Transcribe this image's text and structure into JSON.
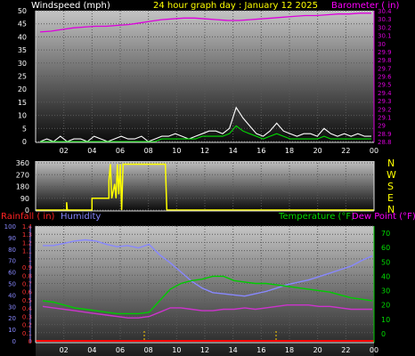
{
  "colors": {
    "background": "#000000",
    "windspeed": "#ffffff",
    "gust": "#00dd00",
    "barometer": "#dd00dd",
    "wind_dir": "#ffff00",
    "rainfall": "#ff0000",
    "rain_axis": "#ff3333",
    "humidity": "#8888ff",
    "temperature": "#00cc00",
    "dew_point": "#cc33cc",
    "dew_title": "#ff00ff",
    "tick_text": "#ffffff",
    "marker": "#ffcc00"
  },
  "header": {
    "windspeed_label": "Windspeed (mph)",
    "title": "24 hour graph day : January 12 2025",
    "barometer_label": "Barometer ( in)"
  },
  "compass": [
    "N",
    "W",
    "S",
    "E",
    "N"
  ],
  "bottom_labels": {
    "rainfall": "Rainfall ( in)",
    "humidity": "Humidity",
    "temperature": "Temperature (°F)",
    "dew_point": "Dew Point (°F)"
  },
  "chart_data": [
    {
      "type": "line",
      "x_ticks": [
        "02",
        "04",
        "06",
        "08",
        "10",
        "12",
        "14",
        "16",
        "18",
        "20",
        "22",
        "00"
      ],
      "y_left_ticks": [
        0,
        5,
        10,
        15,
        20,
        25,
        30,
        35,
        40,
        45,
        50
      ],
      "ylim_left": [
        0,
        50
      ],
      "y_right_ticks": [
        "28.8",
        "28.9",
        "29",
        "29.1",
        "29.2",
        "29.3",
        "29.4",
        "29.5",
        "29.6",
        "29.7",
        "29.8",
        "29.9",
        "30",
        "30.1",
        "30.2",
        "30.3",
        "30.4"
      ],
      "ylim_right": [
        28.8,
        30.4
      ],
      "series": [
        {
          "name": "Windspeed",
          "axis": "left",
          "color": "#ffffff",
          "values": [
            0,
            1,
            0,
            2,
            0,
            1,
            1,
            0,
            2,
            1,
            0,
            1,
            2,
            1,
            1,
            2,
            0,
            1,
            2,
            2,
            3,
            2,
            1,
            2,
            3,
            4,
            4,
            3,
            5,
            13,
            9,
            6,
            3,
            2,
            4,
            7,
            4,
            3,
            2,
            3,
            3,
            2,
            5,
            3,
            2,
            3,
            2,
            3,
            2,
            2
          ]
        },
        {
          "name": "Gust",
          "axis": "left",
          "color": "#00dd00",
          "values": [
            0,
            0,
            0,
            0,
            0,
            0,
            0,
            0,
            0,
            0,
            0,
            0,
            0,
            0,
            0,
            0,
            0,
            0,
            1,
            1,
            1,
            1,
            1,
            1,
            2,
            2,
            2,
            2,
            3,
            6,
            4,
            3,
            2,
            1,
            2,
            3,
            2,
            1,
            1,
            1,
            1,
            1,
            2,
            1,
            1,
            1,
            1,
            1,
            1,
            1
          ]
        },
        {
          "name": "Barometer",
          "axis": "right",
          "color": "#dd00dd",
          "values": [
            30.14,
            30.15,
            30.17,
            30.19,
            30.2,
            30.21,
            30.21,
            30.22,
            30.23,
            30.25,
            30.27,
            30.29,
            30.3,
            30.31,
            30.31,
            30.3,
            30.29,
            30.28,
            30.28,
            30.29,
            30.3,
            30.31,
            30.32,
            30.33,
            30.34,
            30.34,
            30.35,
            30.36,
            30.36,
            30.37,
            30.37
          ]
        }
      ]
    },
    {
      "type": "line",
      "x_ticks": [
        "02",
        "04",
        "06",
        "08",
        "10",
        "12",
        "14",
        "16",
        "18",
        "20",
        "22",
        "00"
      ],
      "y_ticks": [
        0,
        90,
        180,
        270,
        360
      ],
      "ylim": [
        0,
        360
      ],
      "series": [
        {
          "name": "Wind direction",
          "color": "#ffff00",
          "points": [
            [
              0,
              0
            ],
            [
              2.2,
              0
            ],
            [
              2.2,
              60
            ],
            [
              2.25,
              0
            ],
            [
              4,
              0
            ],
            [
              4,
              90
            ],
            [
              5.2,
              90
            ],
            [
              5.2,
              225
            ],
            [
              5.3,
              350
            ],
            [
              5.4,
              90
            ],
            [
              5.6,
              200
            ],
            [
              5.7,
              90
            ],
            [
              5.8,
              350
            ],
            [
              5.9,
              120
            ],
            [
              6.0,
              350
            ],
            [
              6.1,
              0
            ],
            [
              6.2,
              350
            ],
            [
              9.2,
              350
            ],
            [
              9.3,
              0
            ],
            [
              9.35,
              0
            ],
            [
              24,
              0
            ]
          ]
        }
      ]
    },
    {
      "type": "line",
      "x_ticks": [
        "02",
        "04",
        "06",
        "08",
        "10",
        "12",
        "14",
        "16",
        "18",
        "20",
        "22",
        "00"
      ],
      "humidity_ticks": [
        0,
        10,
        20,
        30,
        40,
        50,
        60,
        70,
        80,
        90,
        100
      ],
      "humidity_lim": [
        0,
        100
      ],
      "rain_ticks": [
        "0",
        "0.1",
        "0.2",
        "0.3",
        "0.4",
        "0.5",
        "0.6",
        "0.7",
        "0.8",
        "0.9",
        "1",
        "1.1",
        "1.2",
        "1.3",
        "1.4"
      ],
      "rain_lim": [
        0,
        1.4
      ],
      "temp_ticks": [
        0,
        10,
        20,
        30,
        40,
        50,
        60,
        70
      ],
      "temp_lim": [
        -5,
        75
      ],
      "series": [
        {
          "name": "Humidity",
          "color": "#8888ff",
          "values": [
            83,
            83,
            85,
            87,
            88,
            87,
            84,
            82,
            83,
            81,
            84,
            75,
            68,
            60,
            52,
            46,
            42,
            41,
            40,
            39,
            41,
            43,
            46,
            49,
            51,
            53,
            56,
            59,
            62,
            65,
            70,
            74
          ]
        },
        {
          "name": "Temperature",
          "color": "#00cc00",
          "values": [
            23,
            22,
            20,
            18,
            17,
            16,
            15,
            14,
            14,
            14,
            15,
            23,
            31,
            35,
            37,
            38,
            40,
            40,
            37,
            36,
            35,
            35,
            34,
            33,
            32,
            31,
            30,
            29,
            27,
            25,
            24,
            23
          ]
        },
        {
          "name": "Dew Point",
          "color": "#cc33cc",
          "values": [
            19,
            18,
            17,
            16,
            15,
            14,
            13,
            12,
            11,
            11,
            12,
            15,
            18,
            18,
            17,
            16,
            16,
            17,
            17,
            18,
            17,
            18,
            19,
            20,
            20,
            20,
            19,
            19,
            18,
            17,
            17,
            17
          ]
        }
      ]
    }
  ]
}
